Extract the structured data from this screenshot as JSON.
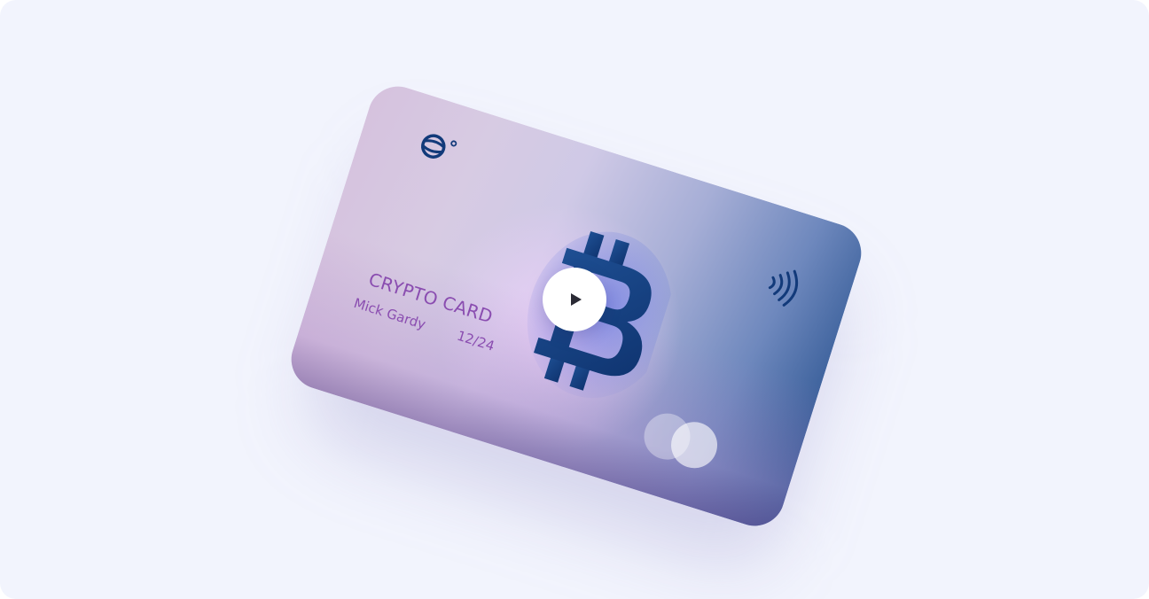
{
  "card": {
    "title": "CRYPTO CARD",
    "holder_name": "Mick Gardy",
    "expiry": "12/24",
    "logo_icon": "globe-logo-icon",
    "contactless_icon": "contactless-icon",
    "network_icon": "mastercard-circles-icon",
    "center_icon": "bitcoin-icon"
  },
  "video": {
    "play_icon": "play-icon"
  },
  "colors": {
    "background": "#f2f4fd",
    "card_text": "#8a4db0",
    "card_icon": "#123a7a",
    "play_button": "#ffffff"
  }
}
